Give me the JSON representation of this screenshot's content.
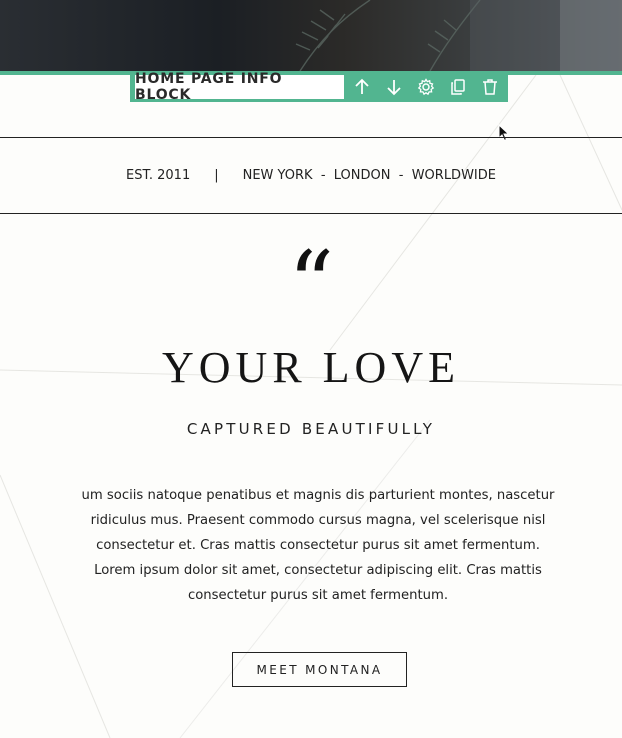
{
  "editor": {
    "block_label": "HOME PAGE INFO BLOCK",
    "accent_color": "#52b590",
    "tools": [
      {
        "name": "arrow-up-icon"
      },
      {
        "name": "arrow-down-icon"
      },
      {
        "name": "gear-icon"
      },
      {
        "name": "copy-icon"
      },
      {
        "name": "trash-icon"
      }
    ]
  },
  "info_bar": {
    "established": "EST. 2011",
    "separator": "|",
    "locations": "NEW YORK  -  LONDON  -  WORLDWIDE"
  },
  "quote_mark": "“",
  "headline": "YOUR LOVE",
  "subheadline": "CAPTURED BEAUTIFULLY",
  "body_text": "um sociis natoque penatibus et magnis dis parturient montes, nascetur ridiculus mus. Praesent commodo cursus magna, vel scelerisque nisl consectetur et. Cras mattis consectetur purus sit amet fermentum. Lorem ipsum dolor sit amet, consectetur adipiscing elit. Cras mattis consectetur purus sit amet fermentum.",
  "cta_label": "MEET MONTANA"
}
